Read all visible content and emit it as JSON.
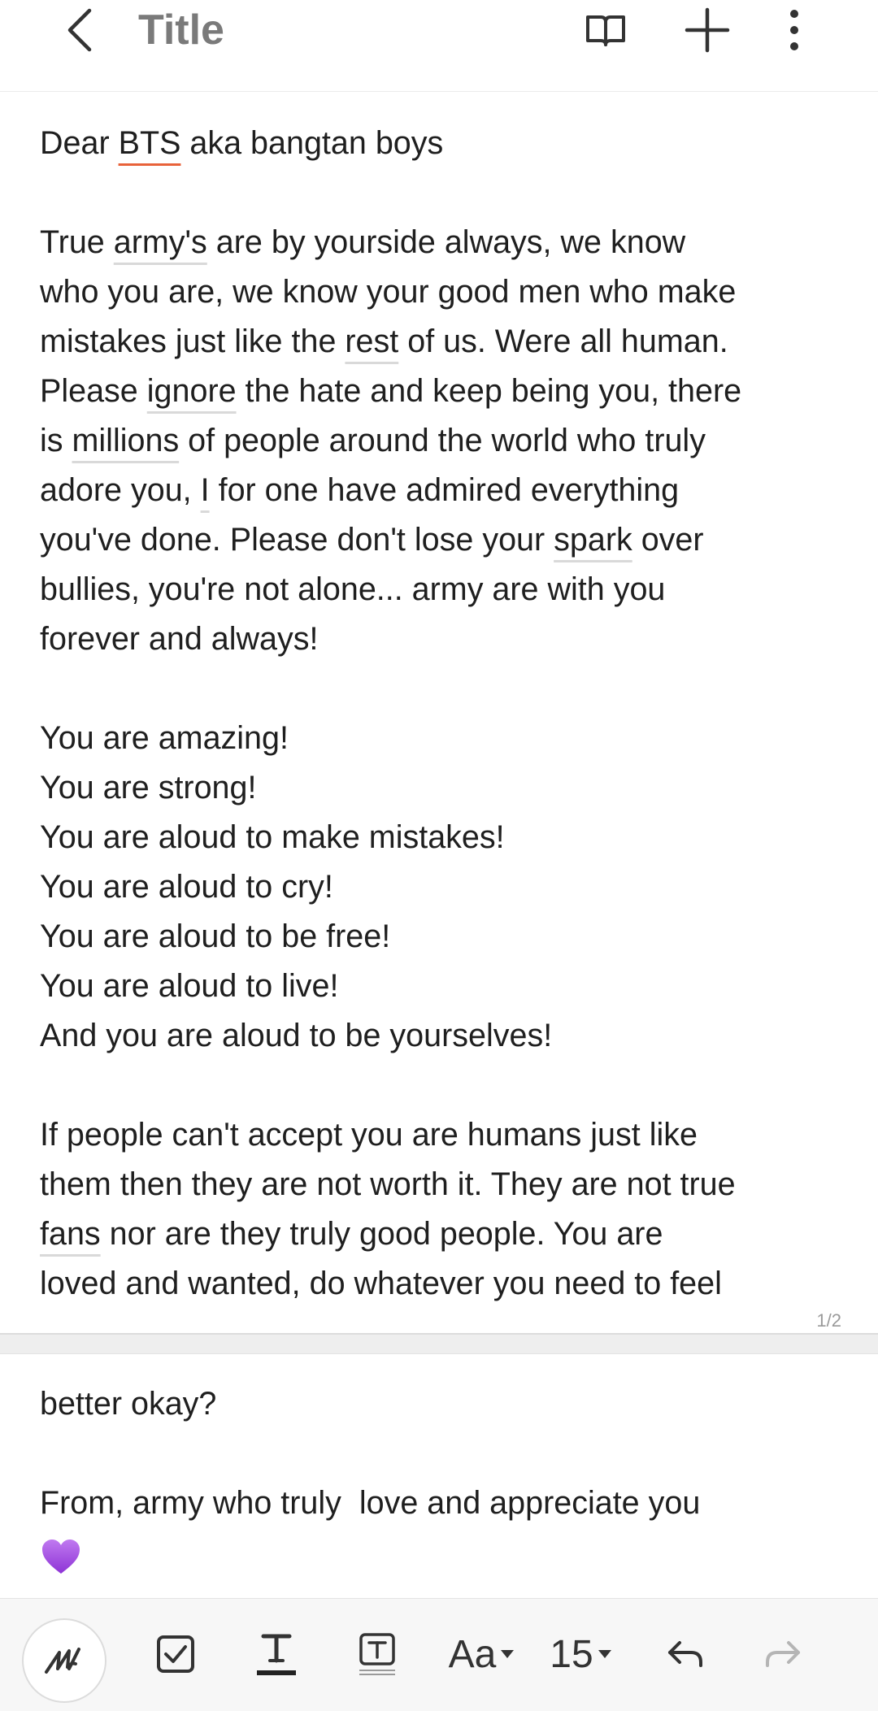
{
  "header": {
    "title": "Title"
  },
  "note": {
    "page1_lines": [
      "Dear BTS aka bangtan boys",
      "",
      "True army's are by yourside always, we know",
      "who you are, we know your good men who make",
      "mistakes just like the rest of us. Were all human.",
      "Please ignore the hate and keep being you, there",
      "is millions of people around the world who truly",
      "adore you, I for one have admired everything",
      "you've done. Please don't lose your spark over",
      "bullies, you're not alone... army are with you",
      "forever and always!",
      "",
      "You are amazing!",
      "You are strong!",
      "You are aloud to make mistakes!",
      "You are aloud to cry!",
      "You are aloud to be free!",
      "You are aloud to live!",
      "And you are aloud to be yourselves!",
      "",
      "If people can't accept you are humans just like",
      "them then they are not worth it. They are not true",
      "fans nor are they truly good people. You are",
      "loved and wanted, do whatever you need to feel"
    ],
    "page_indicator": "1/2",
    "page2_lines": [
      "better okay?",
      "",
      "From, army who truly  love and appreciate you"
    ],
    "heart_emoji": "purple-heart",
    "spell_underline_color": "#d9d9d9",
    "error_underline_color": "#e8623a"
  },
  "toolbar": {
    "font_label": "Aa",
    "size_label": "15"
  },
  "colors": {
    "heart": "#a54ce0",
    "icon": "#333333",
    "disabled_icon": "#b5b5b5"
  }
}
